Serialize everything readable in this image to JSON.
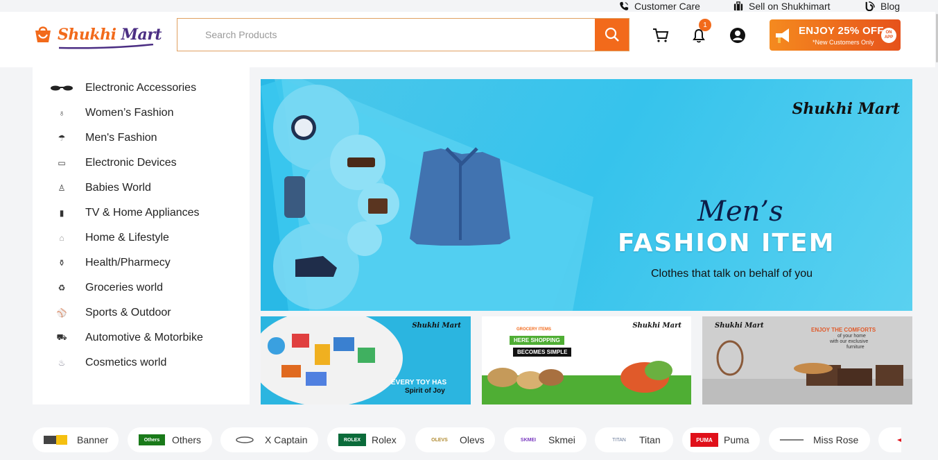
{
  "topbar": {
    "links": [
      {
        "label": "Customer Care",
        "icon": "phone-icon"
      },
      {
        "label": "Sell on Shukhimart",
        "icon": "briefcase-icon"
      },
      {
        "label": "Blog",
        "icon": "blog-icon"
      }
    ]
  },
  "header": {
    "logo": {
      "part1": "Shukhi",
      "part2": " Mart"
    },
    "search": {
      "placeholder": "Search Products",
      "value": ""
    },
    "cart_badge": "1",
    "promo": {
      "title": "ENJOY 25% OFF",
      "subtitle": "*New Customers Only",
      "app": "ON APP"
    }
  },
  "sidebar": {
    "categories": [
      {
        "label": "Electronic Accessories",
        "icon": "glasses-icon"
      },
      {
        "label": "Women’s Fashion",
        "icon": "dress-icon"
      },
      {
        "label": "Men's Fashion",
        "icon": "shirt-icon"
      },
      {
        "label": "Electronic Devices",
        "icon": "laptop-icon"
      },
      {
        "label": "Babies World",
        "icon": "baby-icon"
      },
      {
        "label": "TV & Home Appliances",
        "icon": "fridge-icon"
      },
      {
        "label": "Home & Lifestyle",
        "icon": "lamp-icon"
      },
      {
        "label": "Health/Pharmecy",
        "icon": "medicine-icon"
      },
      {
        "label": "Groceries world",
        "icon": "basket-icon"
      },
      {
        "label": "Sports & Outdoor",
        "icon": "sports-icon"
      },
      {
        "label": "Automotive & Motorbike",
        "icon": "car-icon"
      },
      {
        "label": "Cosmetics world",
        "icon": "cosmetics-icon"
      }
    ]
  },
  "hero": {
    "brand": "Shukhi Mart",
    "script": "Men’s",
    "title": "FASHION ITEM",
    "subtitle": "Clothes that talk on behalf of you"
  },
  "tiles": [
    {
      "brand": "Shukhi Mart",
      "line1": "EVERY TOY HAS",
      "line2": "Spirit of Joy"
    },
    {
      "brand": "Shukhi Mart",
      "tag": "GROCERY ITEMS",
      "line1": "HERE SHOPPING",
      "line2": "BECOMES SIMPLE"
    },
    {
      "brand": "Shukhi Mart",
      "line1": "ENJOY THE COMFORTS",
      "line2": "of your home",
      "line3": "with our exclusive",
      "line4": "furniture"
    }
  ],
  "brands": [
    {
      "name": "Banner"
    },
    {
      "name": "Others",
      "logo_text": "Others"
    },
    {
      "name": "X Captain"
    },
    {
      "name": "Rolex",
      "logo_text": "ROLEX"
    },
    {
      "name": "Olevs",
      "logo_text": "OLEVS"
    },
    {
      "name": "Skmei",
      "logo_text": "SKMEI"
    },
    {
      "name": "Titan",
      "logo_text": "TITAN"
    },
    {
      "name": "Puma",
      "logo_text": "PUMA"
    },
    {
      "name": "Miss Rose"
    }
  ],
  "colors": {
    "accent": "#f26a1b",
    "brand_purple": "#4b2e83",
    "hero_bg": "#36c3ec"
  }
}
